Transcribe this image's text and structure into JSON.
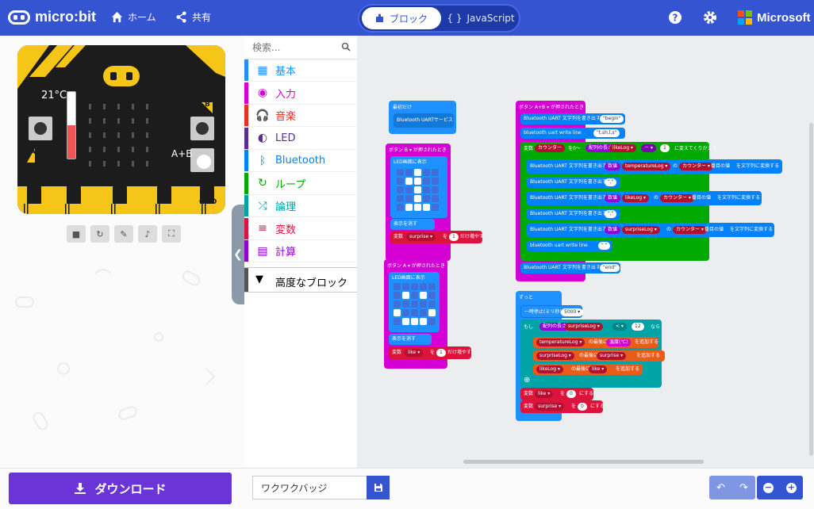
{
  "header": {
    "brand": "micro:bit",
    "home_label": "ホーム",
    "share_label": "共有",
    "tab_blocks": "ブロック",
    "tab_js": "JavaScript",
    "ms_label": "Microsoft",
    "colors": {
      "header_bg": "#3454d1"
    }
  },
  "simulator": {
    "temperature": "21°C",
    "pin_labels": [
      "0",
      "1",
      "2",
      "3V",
      "GND"
    ],
    "btn_a": "A",
    "btn_b": "B",
    "btn_ab": "A+B",
    "thermometer_level": 0.5,
    "controls": [
      "stop-icon",
      "restart-icon",
      "debug-icon",
      "mute-icon",
      "fullscreen-icon"
    ]
  },
  "toolbox": {
    "search_placeholder": "検索...",
    "categories": [
      {
        "label": "基本",
        "color": "#1e90ff",
        "icon": "grid-icon"
      },
      {
        "label": "入力",
        "color": "#d400d4",
        "icon": "target-icon"
      },
      {
        "label": "音楽",
        "color": "#e63022",
        "icon": "headphones-icon"
      },
      {
        "label": "LED",
        "color": "#5c2d91",
        "icon": "toggle-icon"
      },
      {
        "label": "Bluetooth",
        "color": "#0082fb",
        "icon": "bluetooth-icon"
      },
      {
        "label": "ループ",
        "color": "#00aa00",
        "icon": "refresh-icon"
      },
      {
        "label": "論理",
        "color": "#00a4a6",
        "icon": "shuffle-icon"
      },
      {
        "label": "変数",
        "color": "#dc143c",
        "icon": "list-icon"
      },
      {
        "label": "計算",
        "color": "#9400d3",
        "icon": "calculator-icon"
      }
    ],
    "advanced_label": "高度なブロック"
  },
  "blocks": {
    "on_start": "最初だけ",
    "bt_uart_service": "Bluetooth UARTサービス",
    "on_btn_b": "ボタン B ▾ が押されたとき",
    "show_leds": "LED画面に表示",
    "clear_screen": "表示を消す",
    "change_by_label": "変数",
    "surprise_var": "surprise ▾",
    "wo": "を",
    "one": "1",
    "dake_increase": "だけ増やす",
    "on_btn_a": "ボタン A ▾ が押されたとき",
    "like_var": "like ▾",
    "on_btn_ab": "ボタン A+B ▾ が押されたとき",
    "write_string": "Bluetooth UART 文字列を書き出す",
    "begin_str": "\"begin\"",
    "write_line": "bluetooth uart write line",
    "header_str": "\"t,sh,l,s\"",
    "counter_loop_a": "変数",
    "counter_var": "カウンター",
    "loop_from": "を0～",
    "array_len": "配列の長さ",
    "likelog_var": "likeLog ▾",
    "minus": "－ ▾",
    "loop_end": "に変えてくりかえす",
    "number": "数値",
    "temp_log_var": "temperatureLog ▾",
    "no": "の",
    "counter_pill": "カウンター ▾",
    "item_to_str": "番目の値",
    "to_str": "を文字列に変換する",
    "comma_str": "\",\"",
    "surp_log_var": "surpriseLog ▾",
    "empty_str": "\" \"",
    "end_str": "\"end\"",
    "forever": "ずっと",
    "pause": "一時停止(ミリ秒)",
    "pause_val": "5000 ▾",
    "if_label": "もし",
    "lt": "< ▾",
    "twelve": "12",
    "then": "なら",
    "temp_log_pill": "temperatureLog ▾",
    "append_end": "の最後に",
    "temp_value": "温度(℃)",
    "append_add": "を追加する",
    "surp_log_pill": "surpriseLog ▾",
    "surprise_pill": "surprise ▾",
    "likelog_pill": "likeLog ▾",
    "like_pill": "like ▾",
    "set_var": "変数",
    "zero": "0",
    "set_to": "にする"
  },
  "bottom": {
    "download_label": "ダウンロード",
    "project_name": "ワクワクバッジ"
  }
}
